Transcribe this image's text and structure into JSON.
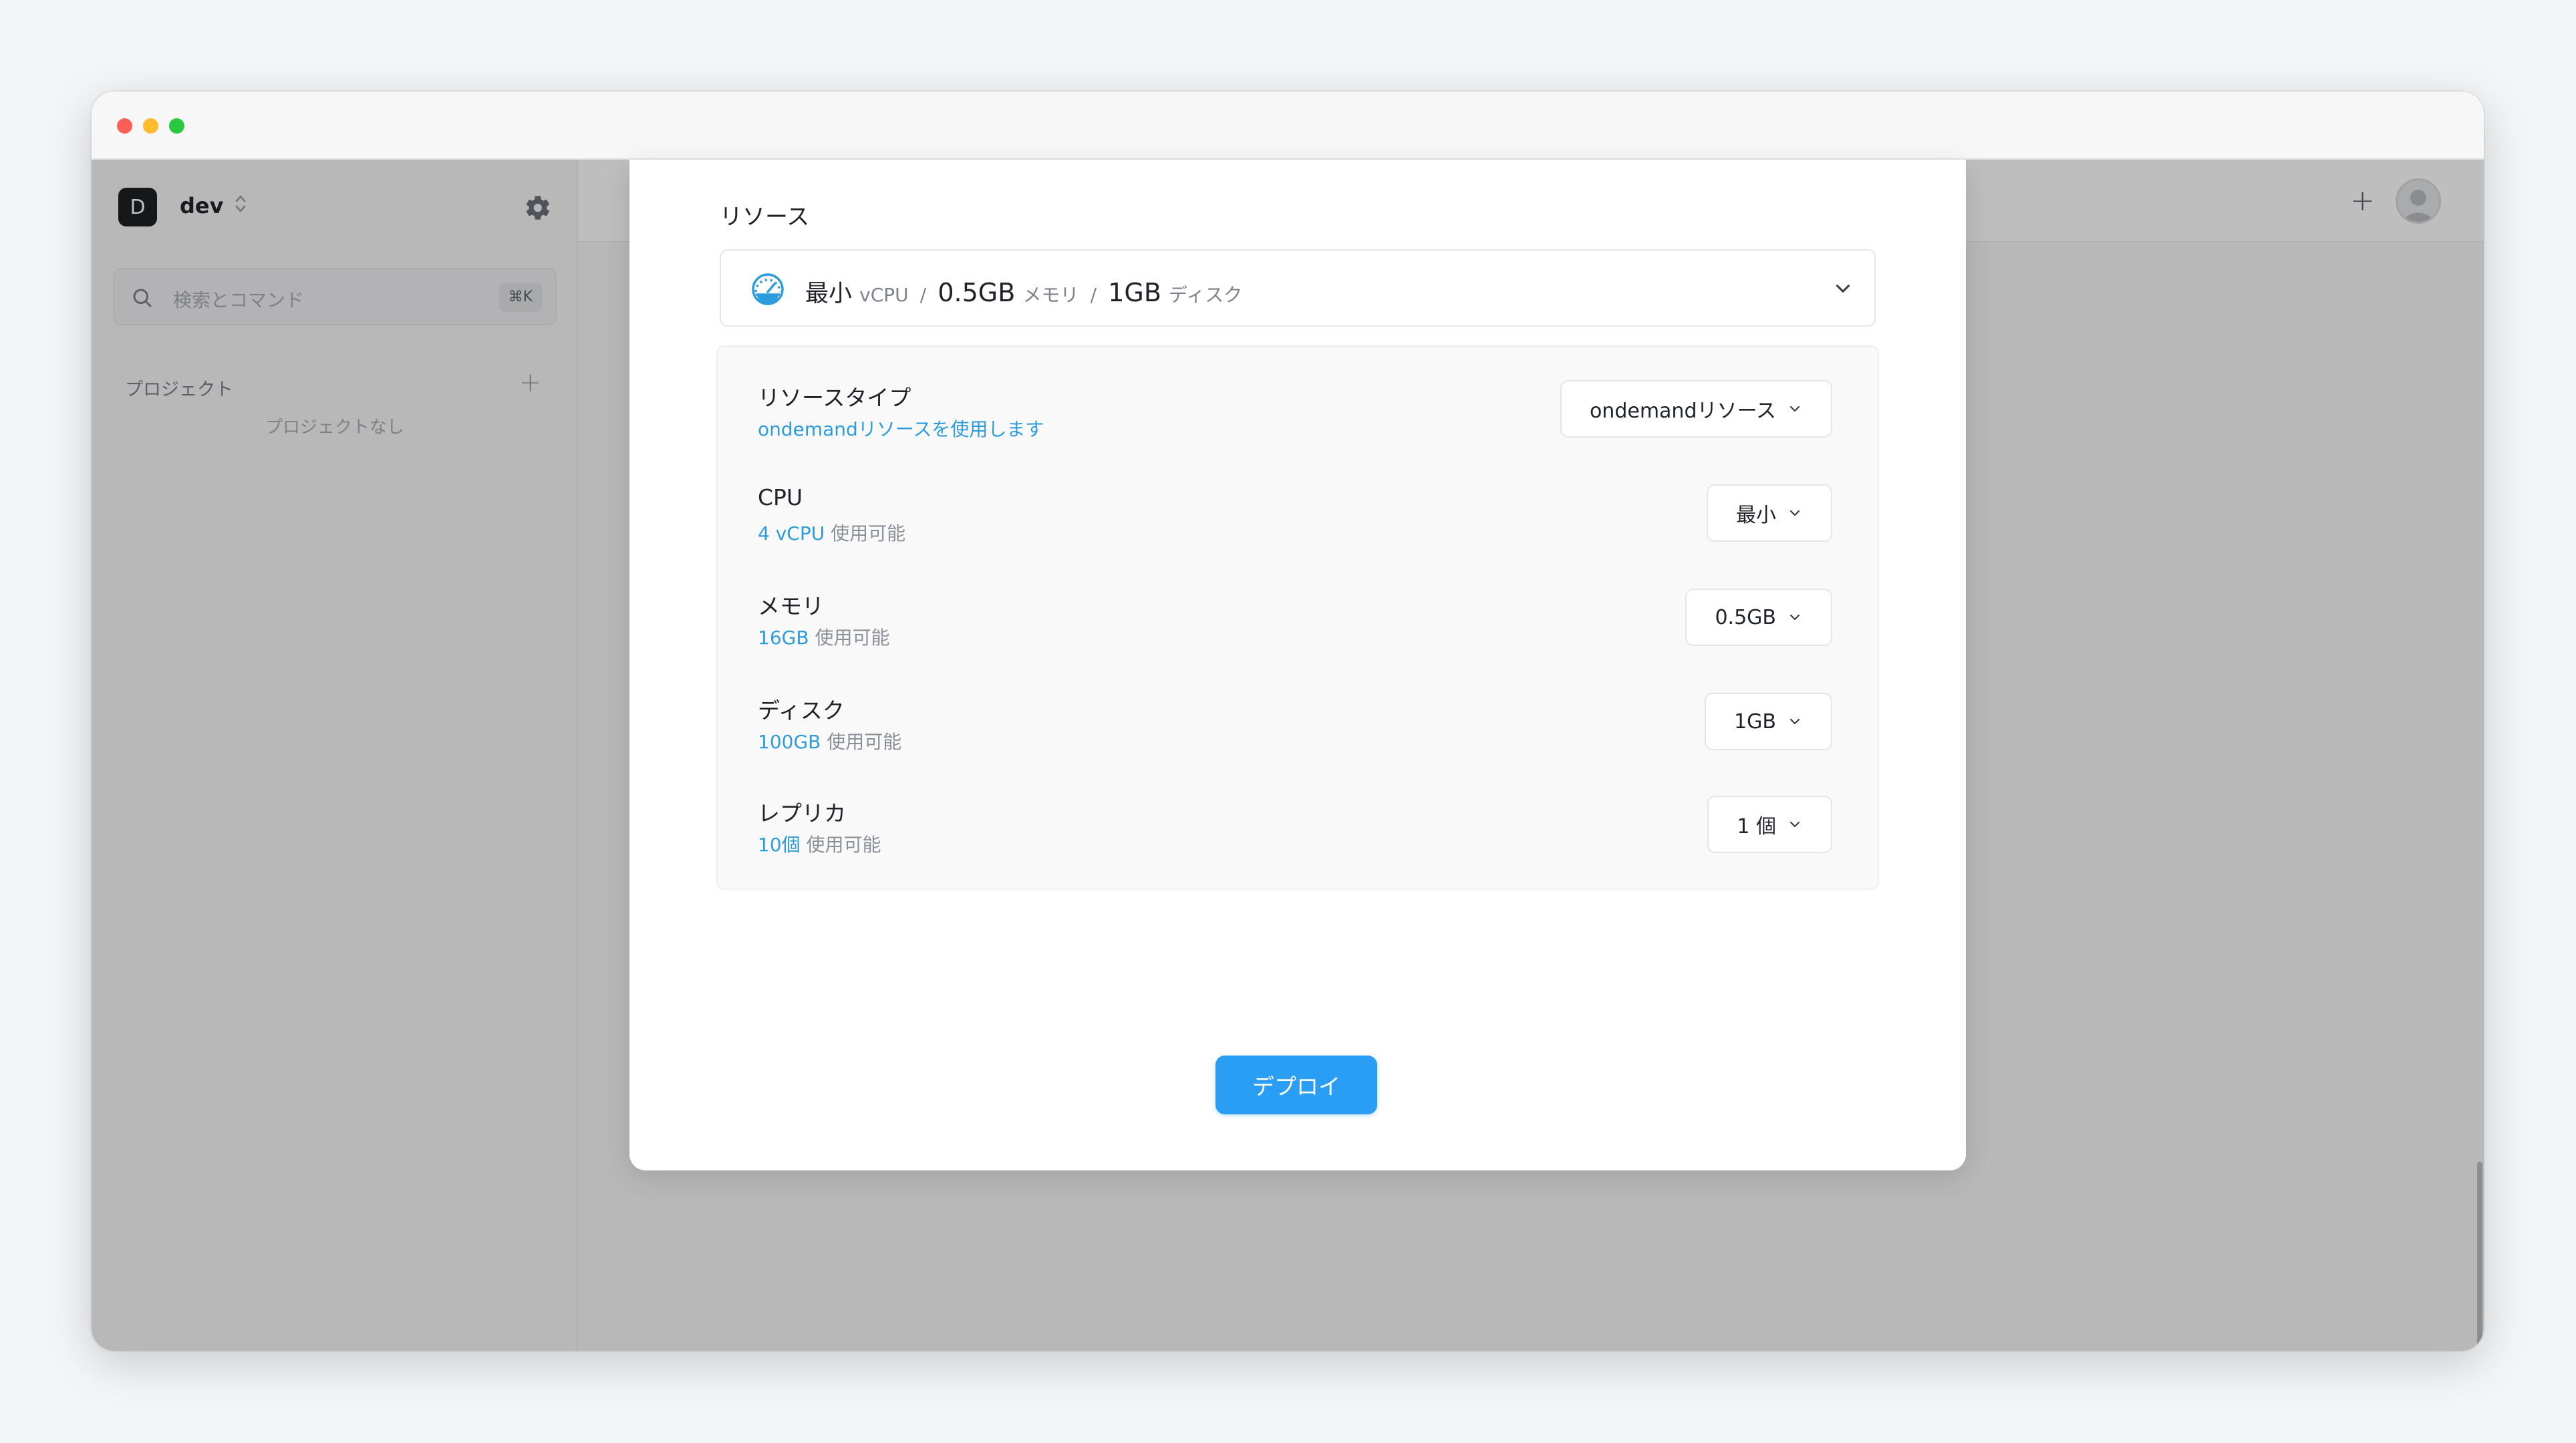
{
  "window": {
    "controls": [
      "close",
      "minimize",
      "maximize"
    ]
  },
  "sidebar": {
    "workspace_initial": "D",
    "workspace_name": "dev",
    "search_placeholder": "検索とコマンド",
    "search_shortcut": "⌘K",
    "projects_label": "プロジェクト",
    "projects_add": "+",
    "projects_empty": "プロジェクトなし"
  },
  "header": {
    "new_label": "+"
  },
  "modal": {
    "resource_title": "リソース",
    "summary": {
      "cpu_value": "最小",
      "cpu_unit": "vCPU",
      "separator": "/",
      "memory_value": "0.5GB",
      "memory_unit": "メモリ",
      "disk_value": "1GB",
      "disk_unit": "ディスク"
    },
    "rows": [
      {
        "title": "リソースタイプ",
        "sub_prefix": "ondemandリソースを使用します",
        "sub_suffix": "",
        "value": "ondemandリソース"
      },
      {
        "title": "CPU",
        "sub_prefix": "4 vCPU",
        "sub_suffix": "使用可能",
        "value": "最小"
      },
      {
        "title": "メモリ",
        "sub_prefix": "16GB",
        "sub_suffix": "使用可能",
        "value": "0.5GB"
      },
      {
        "title": "ディスク",
        "sub_prefix": "100GB",
        "sub_suffix": "使用可能",
        "value": "1GB"
      },
      {
        "title": "レプリカ",
        "sub_prefix": "10個",
        "sub_suffix": "使用可能",
        "value": "1 個"
      }
    ],
    "deploy_label": "デプロイ"
  },
  "colors": {
    "accent": "#2a9ef4",
    "highlight_text": "#2d9cdb",
    "overlay": "rgba(0,0,0,0.255)"
  }
}
